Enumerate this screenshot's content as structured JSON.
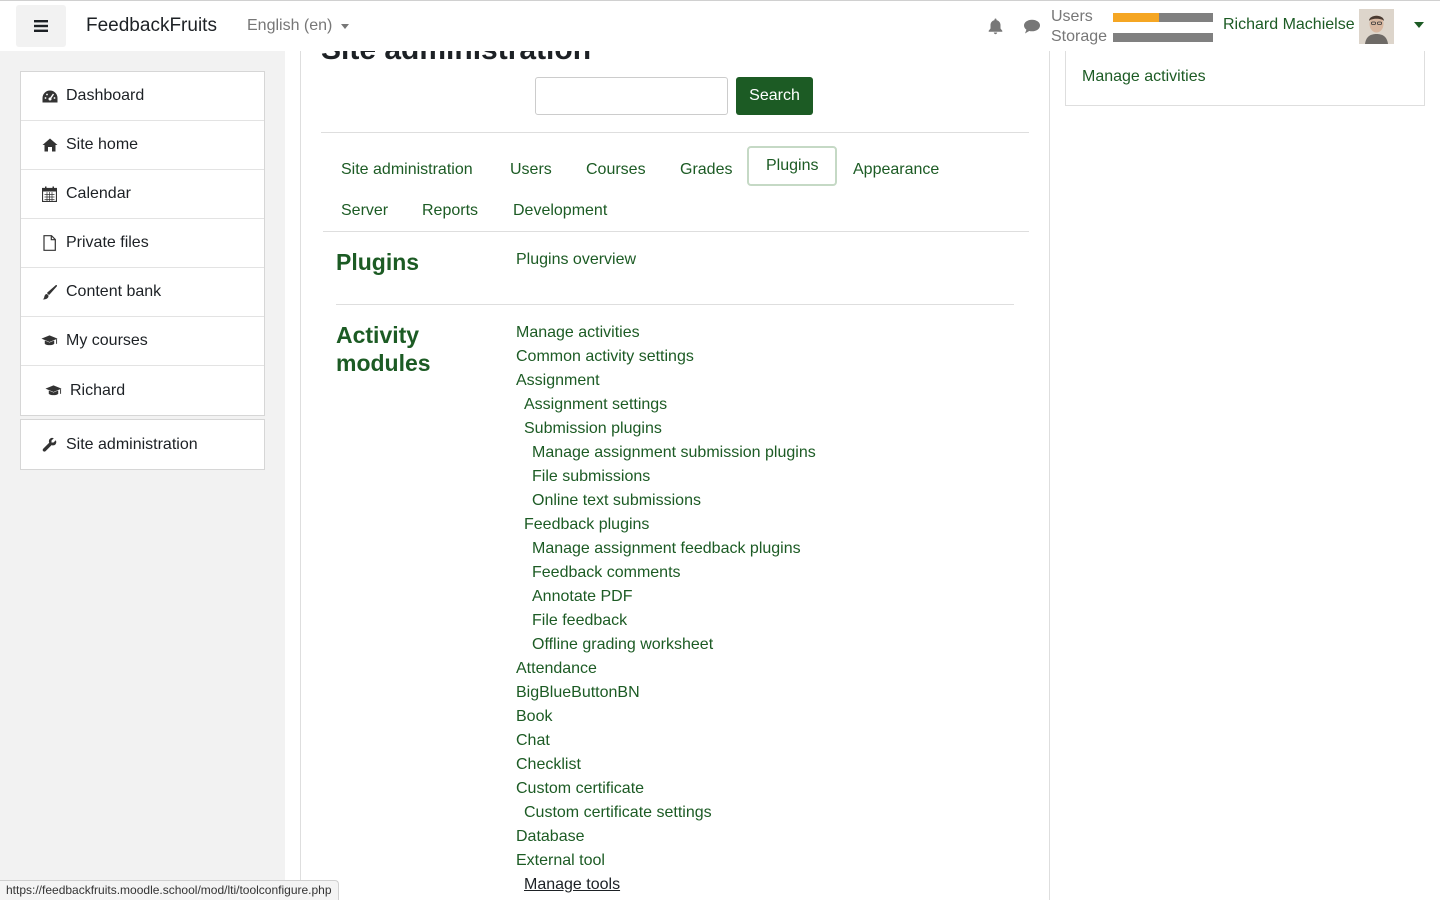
{
  "navbar": {
    "brand": "FeedbackFruits",
    "language": "English (en)",
    "users_label": "Users",
    "storage_label": "Storage",
    "users_usage": 0.46,
    "storage_usage": 0.0,
    "user_name": "Richard Machielse"
  },
  "drawer": {
    "items": [
      {
        "label": "Dashboard",
        "icon": "dashboard-icon"
      },
      {
        "label": "Site home",
        "icon": "home-icon"
      },
      {
        "label": "Calendar",
        "icon": "calendar-icon"
      },
      {
        "label": "Private files",
        "icon": "file-icon"
      },
      {
        "label": "Content bank",
        "icon": "brush-icon"
      },
      {
        "label": "My courses",
        "icon": "graduation-cap-icon"
      },
      {
        "label": "Richard",
        "icon": "graduation-cap-icon"
      }
    ],
    "admin_label": "Site administration"
  },
  "main": {
    "heading": "Site administration",
    "search_value": "",
    "search_button": "Search",
    "tabs": [
      "Site administration",
      "Users",
      "Courses",
      "Grades",
      "Plugins",
      "Appearance",
      "Server",
      "Reports",
      "Development"
    ],
    "active_tab": "Plugins",
    "sections": [
      {
        "title": "Plugins",
        "links": [
          "Plugins overview"
        ]
      },
      {
        "title": "Activity modules",
        "title_lines": [
          "Activity",
          "modules"
        ]
      }
    ],
    "activity_links": [
      "Manage activities",
      "Common activity settings",
      "Assignment",
      "Assignment settings",
      "Submission plugins",
      "Manage assignment submission plugins",
      "File submissions",
      "Online text submissions",
      "Feedback plugins",
      "Manage assignment feedback plugins",
      "Feedback comments",
      "Annotate PDF",
      "File feedback",
      "Offline grading worksheet",
      "Attendance",
      "BigBlueButtonBN",
      "Book",
      "Chat",
      "Checklist",
      "Custom certificate",
      "Custom certificate settings",
      "Database",
      "External tool",
      "Manage tools"
    ]
  },
  "right_block": {
    "link": "Manage activities"
  },
  "status_url": "https://feedbackfruits.moodle.school/mod/lti/toolconfigure.php",
  "colors": {
    "brand_green": "#1c5b24",
    "quota_orange": "#f5a623",
    "quota_gray": "#808080"
  }
}
